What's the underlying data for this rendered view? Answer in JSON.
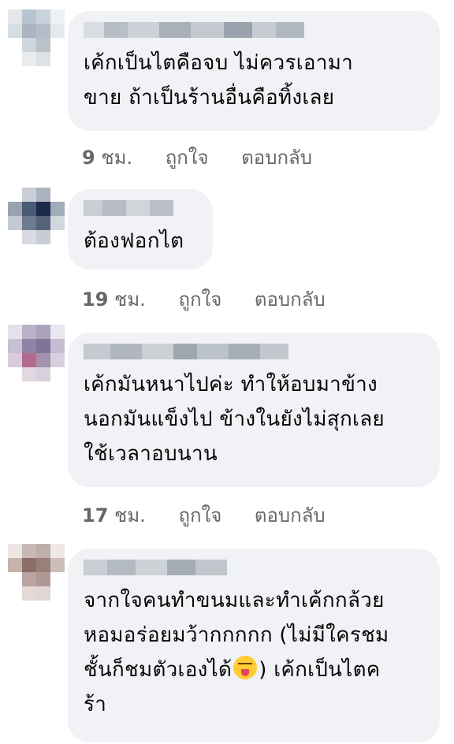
{
  "comments": [
    {
      "text_lines": [
        "เค้กเป็นไตคือจบ ไม่ควรเอามา",
        "ขาย ถ้าเป็นร้านอื่นคือทิ้งเลย"
      ],
      "time_num": "9",
      "time_unit": "ชม.",
      "like_label": "ถูกใจ",
      "reply_label": "ตอบกลับ"
    },
    {
      "text_lines": [
        "ต้องฟอกไต"
      ],
      "time_num": "19",
      "time_unit": "ชม.",
      "like_label": "ถูกใจ",
      "reply_label": "ตอบกลับ"
    },
    {
      "text_lines": [
        "เค้กมันหนาไปค่ะ ทำให้อบมาข้าง",
        "นอกมันแข็งไป ข้างในยังไม่สุกเลย",
        "ใช้เวลาอบนาน"
      ],
      "time_num": "17",
      "time_unit": "ชม.",
      "like_label": "ถูกใจ",
      "reply_label": "ตอบกลับ"
    },
    {
      "text_lines": [
        "จากใจคนทำขนมและทำเค้กกล้วย",
        "หอมอร่อยมว้ากกกกก (ไม่มีใครชม",
        "ชั้นก็ชมตัวเองได้",
        ") เค้กเป็นไตค",
        "ร้า"
      ],
      "emoji": "squinting-tongue-face-emoji"
    }
  ],
  "colors": {
    "bubble_bg": "#f0f2f5",
    "text": "#050505",
    "meta": "#65676b"
  }
}
